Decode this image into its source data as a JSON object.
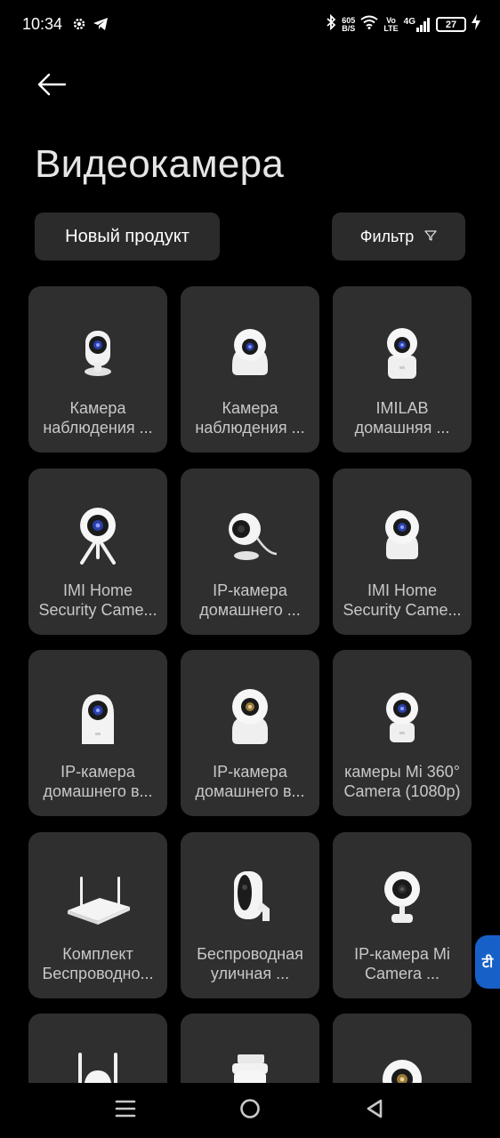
{
  "status_bar": {
    "time": "10:34",
    "net_speed_value": "605",
    "net_speed_unit": "B/S",
    "volte_top": "Vo",
    "volte_bottom": "LTE",
    "network_type": "4G",
    "battery_level": "27"
  },
  "header": {
    "title": "Видеокамера"
  },
  "filters": {
    "new_product_label": "Новый продукт",
    "filter_label": "Фильтр"
  },
  "products": [
    {
      "line1": "Камера",
      "line2": "наблюдения ...",
      "icon": "baby-monitor-camera-icon"
    },
    {
      "line1": "Камера",
      "line2": "наблюдения ...",
      "icon": "ptz-camera-icon"
    },
    {
      "line1": "IMILAB",
      "line2": "домашняя ...",
      "icon": "square-base-camera-icon"
    },
    {
      "line1": "IMI Home",
      "line2": "Security Came...",
      "icon": "tripod-camera-icon"
    },
    {
      "line1": "IP-камера",
      "line2": "домашнего ...",
      "icon": "magnetic-camera-icon"
    },
    {
      "line1": "IMI Home",
      "line2": "Security Came...",
      "icon": "ptz-camera-icon"
    },
    {
      "line1": "IP-камера",
      "line2": "домашнего в...",
      "icon": "square-base-camera-icon"
    },
    {
      "line1": "IP-камера",
      "line2": "домашнего в...",
      "icon": "ptz-camera-icon"
    },
    {
      "line1": "камеры Mi 360°",
      "line2": "Camera (1080p)",
      "icon": "ptz-camera-icon"
    },
    {
      "line1": "Комплект",
      "line2": "Беспроводно...",
      "icon": "router-kit-icon"
    },
    {
      "line1": "Беспроводная",
      "line2": "уличная ...",
      "icon": "outdoor-camera-icon"
    },
    {
      "line1": "IP-камера Mi",
      "line2": "Camera ...",
      "icon": "stand-camera-icon"
    },
    {
      "line1": "",
      "line2": "",
      "icon": "outdoor-dual-antenna-camera-icon"
    },
    {
      "line1": "",
      "line2": "",
      "icon": "outdoor-ptz-camera-icon"
    },
    {
      "line1": "",
      "line2": "",
      "icon": "ptz-camera-icon"
    }
  ],
  "floating_badge": {
    "glyph": "टी"
  },
  "colors": {
    "background": "#000000",
    "card": "#2f2f2f",
    "chip": "#2b2b2b",
    "lens_blue": "#2a3fa8",
    "badge_blue": "#1760c8"
  }
}
